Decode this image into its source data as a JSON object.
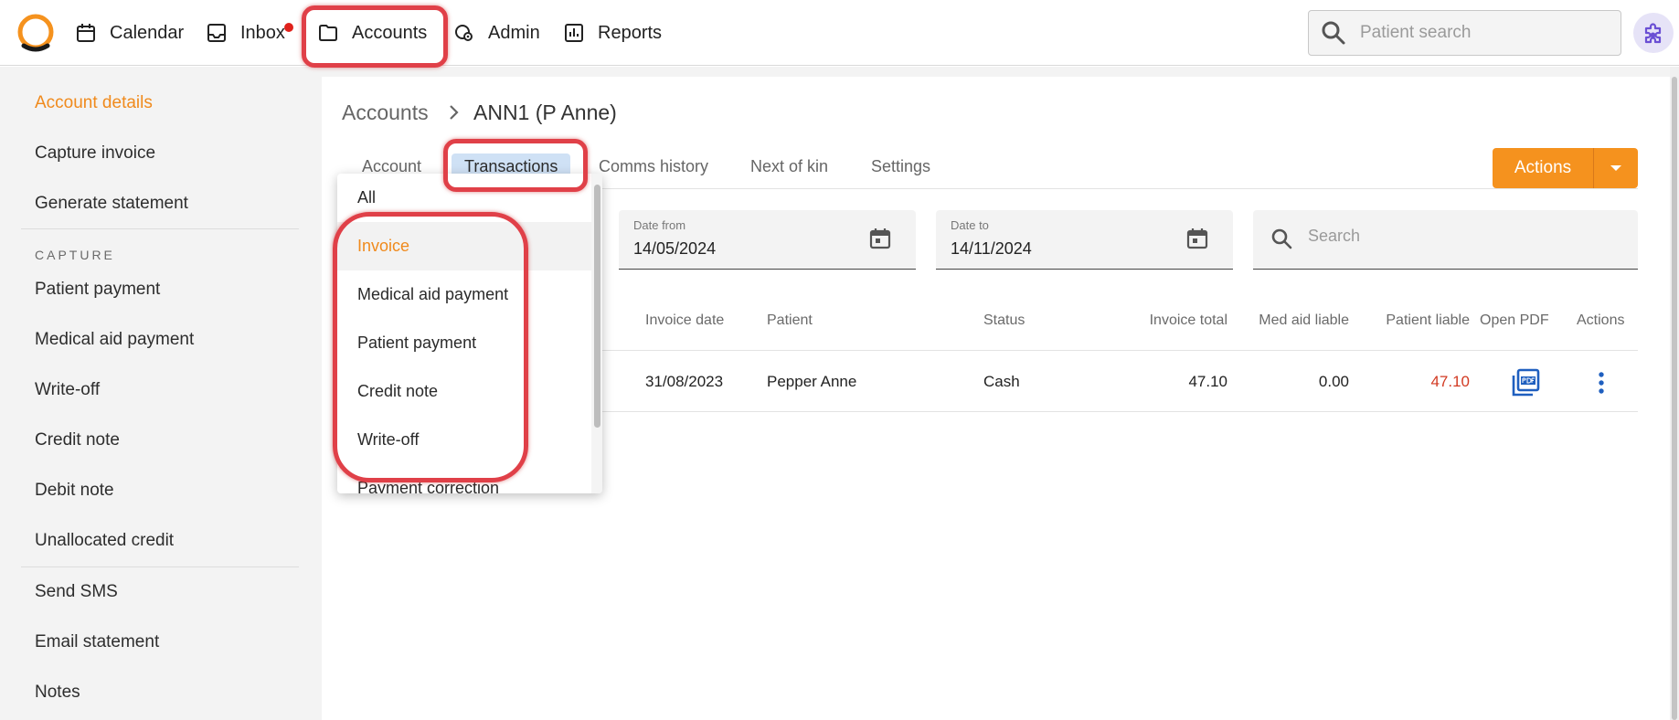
{
  "nav": {
    "items": [
      {
        "label": "Calendar",
        "icon": "calendar-icon"
      },
      {
        "label": "Inbox",
        "icon": "inbox-icon",
        "has_notification": true
      },
      {
        "label": "Accounts",
        "icon": "folder-icon",
        "active": true
      },
      {
        "label": "Admin",
        "icon": "admin-icon"
      },
      {
        "label": "Reports",
        "icon": "reports-icon"
      }
    ],
    "search_placeholder": "Patient search"
  },
  "sidebar": {
    "items": [
      {
        "label": "Account details",
        "active": true
      },
      {
        "label": "Capture invoice"
      },
      {
        "label": "Generate statement"
      },
      {
        "label": "Patient payment"
      },
      {
        "label": "Medical aid payment"
      },
      {
        "label": "Write-off"
      },
      {
        "label": "Credit note"
      },
      {
        "label": "Debit note"
      },
      {
        "label": "Unallocated credit"
      },
      {
        "label": "Send SMS"
      },
      {
        "label": "Email statement"
      },
      {
        "label": "Notes"
      }
    ],
    "section_capture": "CAPTURE"
  },
  "breadcrumb": {
    "root": "Accounts",
    "current": "ANN1 (P Anne)"
  },
  "tabs": [
    {
      "label": "Account"
    },
    {
      "label": "Transactions",
      "selected": true
    },
    {
      "label": "Comms history"
    },
    {
      "label": "Next of kin"
    },
    {
      "label": "Settings"
    }
  ],
  "actions_label": "Actions",
  "filters": {
    "date_from": {
      "label": "Date from",
      "value": "14/05/2024"
    },
    "date_to": {
      "label": "Date to",
      "value": "14/11/2024"
    },
    "search_placeholder": "Search"
  },
  "table": {
    "headers": [
      "Invoice date",
      "Patient",
      "Status",
      "Invoice total",
      "Med aid liable",
      "Patient liable",
      "Open PDF",
      "Actions"
    ],
    "rows": [
      {
        "invoice_date": "31/08/2023",
        "patient": "Pepper Anne",
        "status": "Cash",
        "invoice_total": "47.10",
        "med_aid_liable": "0.00",
        "patient_liable": "47.10"
      }
    ]
  },
  "dropdown": {
    "options": [
      "All",
      "Invoice",
      "Medical aid payment",
      "Patient payment",
      "Credit note",
      "Write-off",
      "Payment correction"
    ],
    "highlighted": "Invoice"
  },
  "colors": {
    "accent_orange": "#f5921e",
    "active_text_orange": "#f08a1c",
    "annotation_red": "#e04048",
    "link_blue": "#1f5fbf",
    "negative_red": "#d23a22"
  }
}
